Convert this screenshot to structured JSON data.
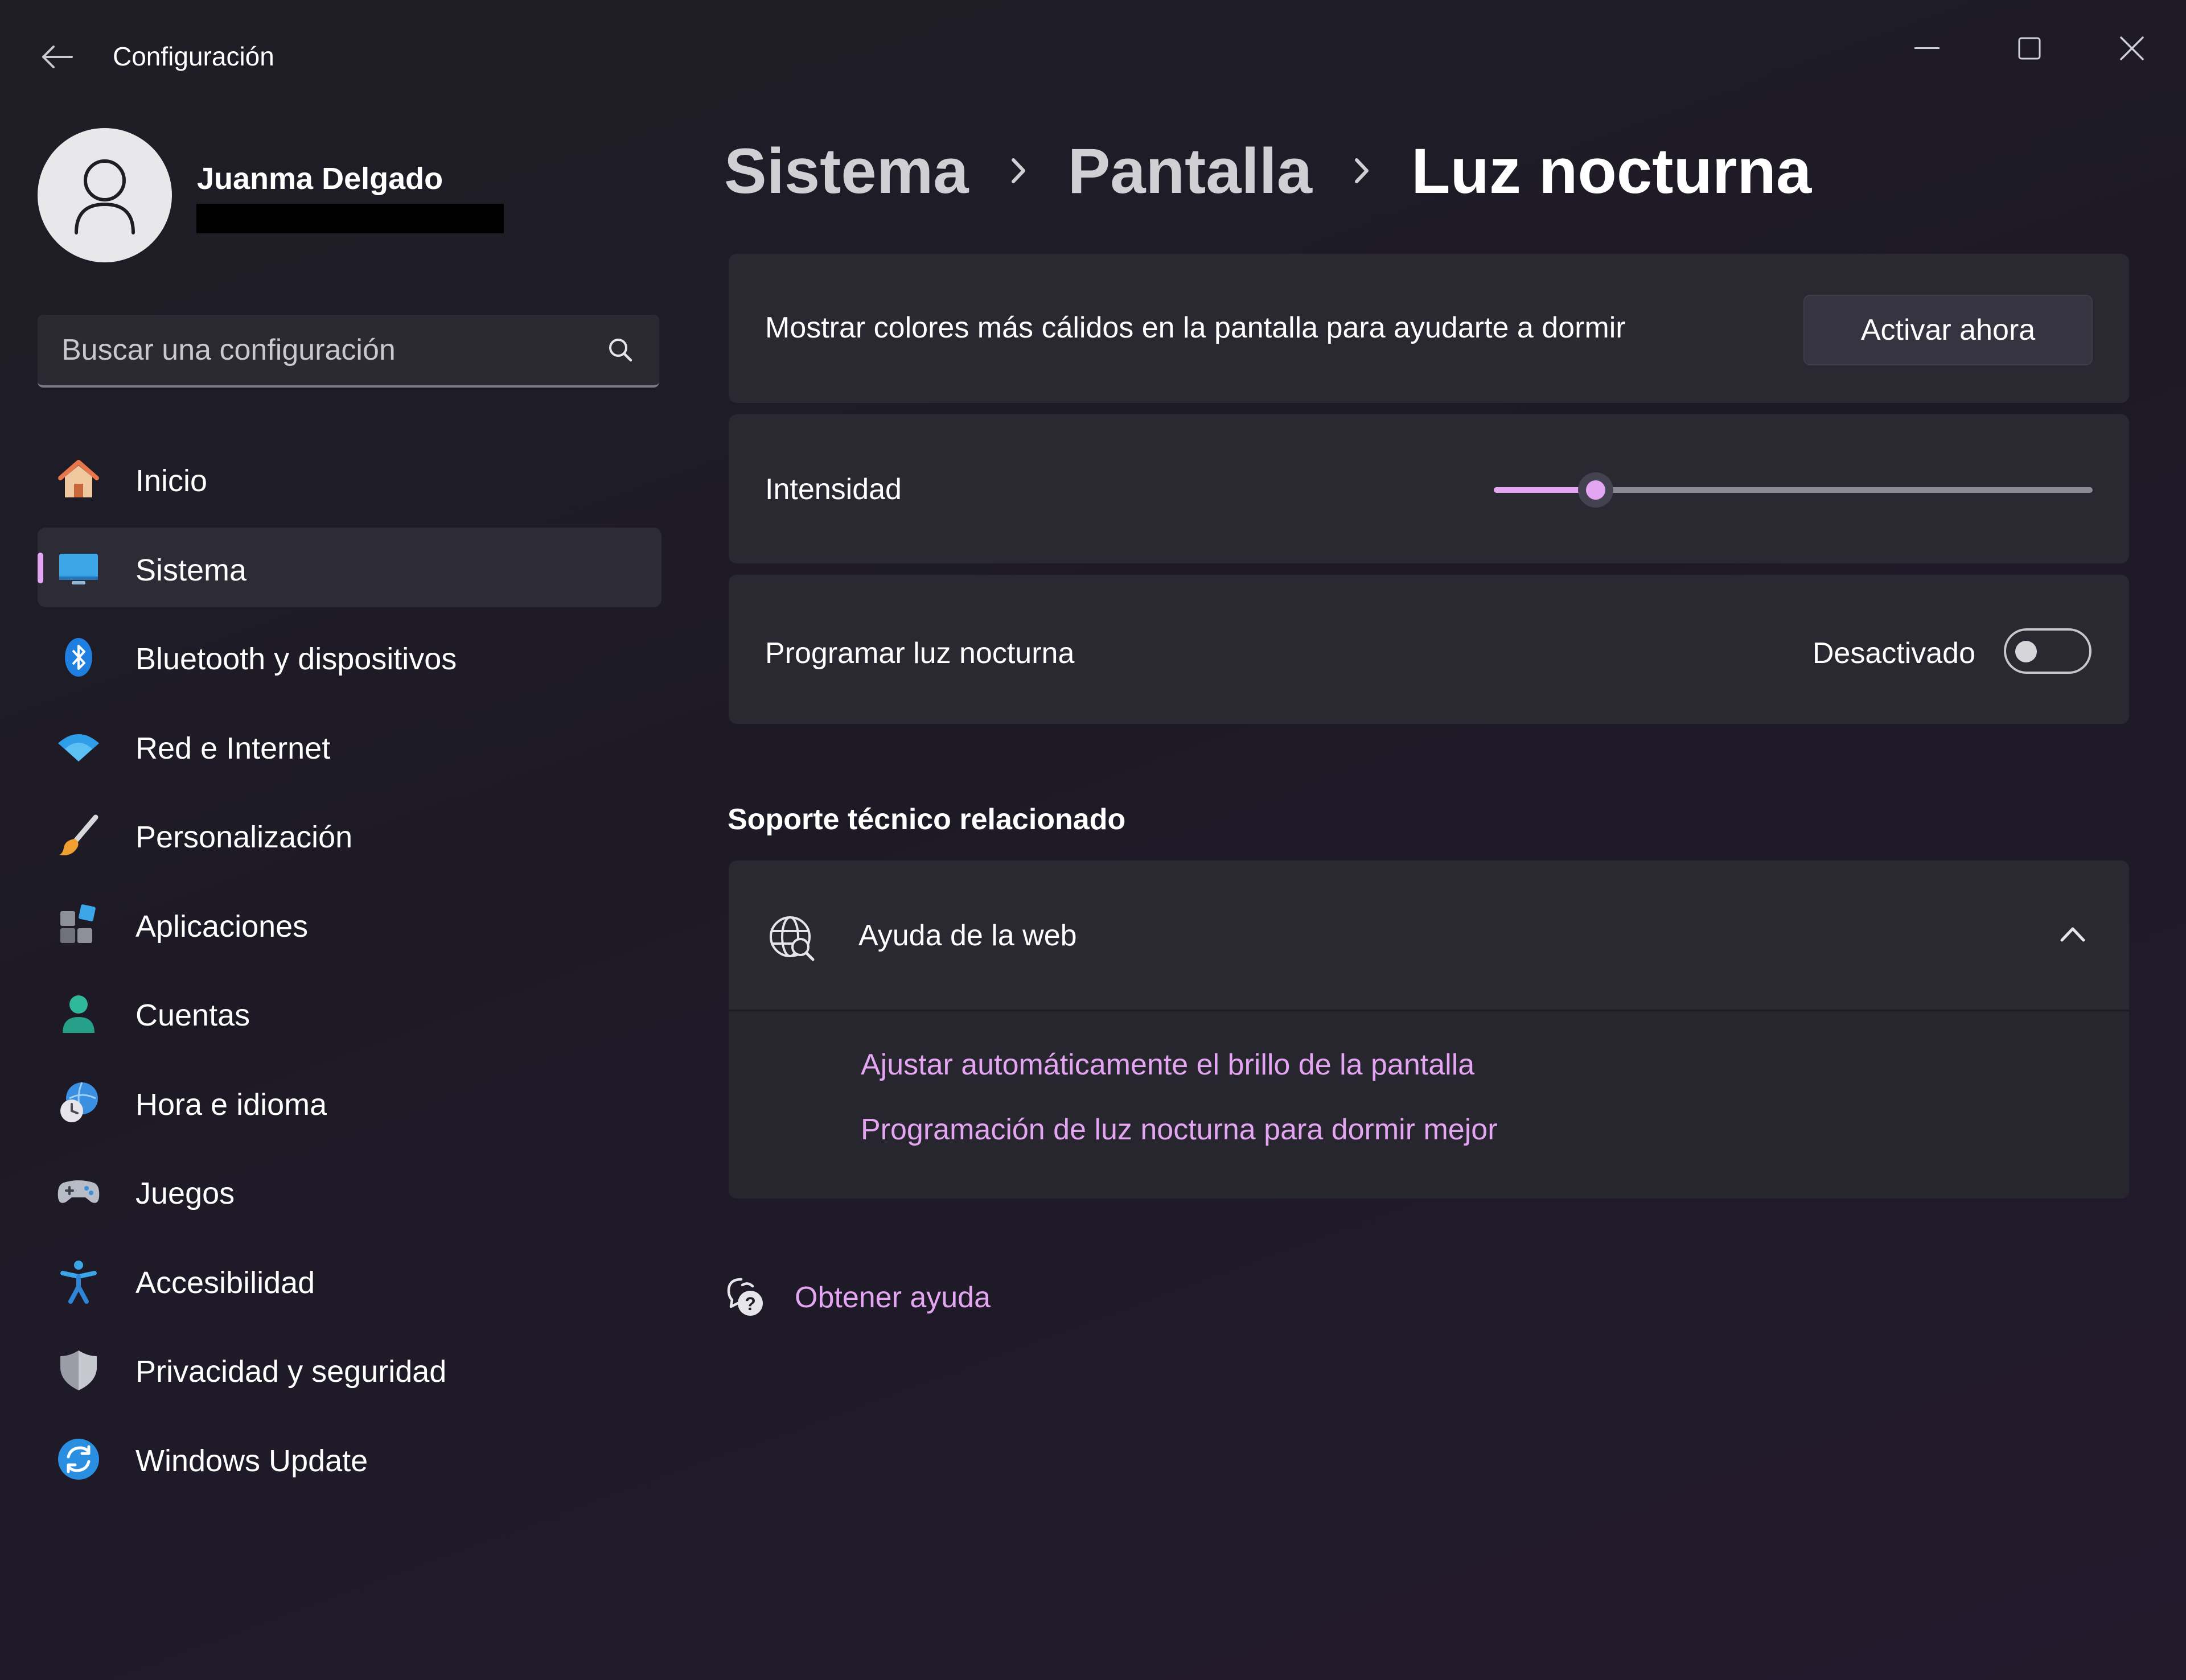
{
  "window": {
    "title": "Configuración"
  },
  "profile": {
    "name": "Juanma Delgado"
  },
  "search": {
    "placeholder": "Buscar una configuración"
  },
  "sidebar": {
    "items": [
      {
        "label": "Inicio",
        "icon": "home-icon",
        "active": false
      },
      {
        "label": "Sistema",
        "icon": "system-icon",
        "active": true
      },
      {
        "label": "Bluetooth y dispositivos",
        "icon": "bluetooth-icon",
        "active": false
      },
      {
        "label": "Red e Internet",
        "icon": "wifi-icon",
        "active": false
      },
      {
        "label": "Personalización",
        "icon": "brush-icon",
        "active": false
      },
      {
        "label": "Aplicaciones",
        "icon": "apps-icon",
        "active": false
      },
      {
        "label": "Cuentas",
        "icon": "accounts-icon",
        "active": false
      },
      {
        "label": "Hora e idioma",
        "icon": "time-language-icon",
        "active": false
      },
      {
        "label": "Juegos",
        "icon": "gamepad-icon",
        "active": false
      },
      {
        "label": "Accesibilidad",
        "icon": "accessibility-icon",
        "active": false
      },
      {
        "label": "Privacidad y seguridad",
        "icon": "shield-icon",
        "active": false
      },
      {
        "label": "Windows Update",
        "icon": "update-icon",
        "active": false
      }
    ]
  },
  "breadcrumb": {
    "items": [
      "Sistema",
      "Pantalla",
      "Luz nocturna"
    ]
  },
  "night_light": {
    "description": "Mostrar colores más cálidos en la pantalla para ayudarte a dormir",
    "activate_button": "Activar ahora",
    "intensity_label": "Intensidad",
    "intensity_value": 17,
    "schedule_label": "Programar luz nocturna",
    "schedule_state": "Desactivado",
    "schedule_on": false
  },
  "support": {
    "section_title": "Soporte técnico relacionado",
    "help_header": "Ayuda de la web",
    "expanded": true,
    "links": [
      "Ajustar automáticamente el brillo de la pantalla",
      "Programación de luz nocturna para dormir mejor"
    ]
  },
  "get_help": {
    "label": "Obtener ayuda"
  },
  "colors": {
    "accent": "#e4a6f2",
    "window_bg": "#1f1e26",
    "card_bg": "#2a2932",
    "selected_nav_bg": "#2d2b36"
  }
}
